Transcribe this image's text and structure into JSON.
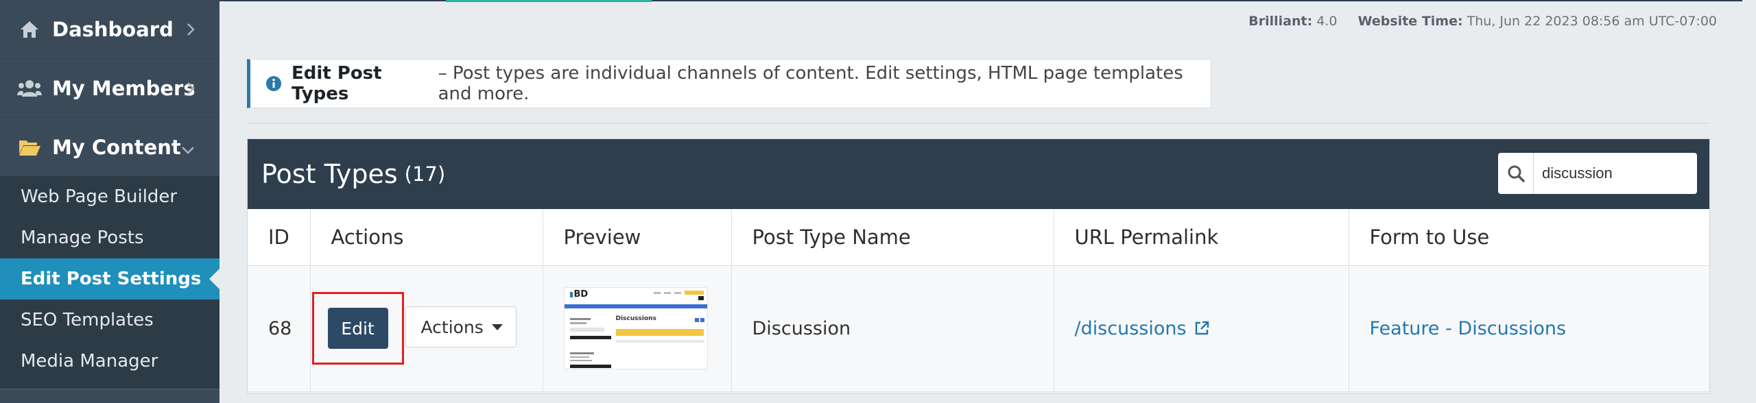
{
  "sidebar": {
    "main_items": [
      {
        "label": "Dashboard",
        "icon": "home-icon"
      },
      {
        "label": "My Members",
        "icon": "users-icon"
      },
      {
        "label": "My Content",
        "icon": "folder-open-icon"
      }
    ],
    "sub_items": [
      {
        "label": "Web Page Builder"
      },
      {
        "label": "Manage Posts"
      },
      {
        "label": "Edit Post Settings",
        "active": true
      },
      {
        "label": "SEO Templates"
      },
      {
        "label": "Media Manager"
      }
    ]
  },
  "meta": {
    "version_label": "Brilliant:",
    "version_value": "4.0",
    "time_label": "Website Time:",
    "time_value": "Thu, Jun 22 2023 08:56 am UTC-07:00"
  },
  "notice": {
    "title": "Edit Post Types",
    "text": "– Post types are individual channels of content. Edit settings, HTML page templates and more."
  },
  "panel": {
    "title": "Post Types",
    "count": "(17)",
    "search_value": "discussion"
  },
  "table": {
    "headers": [
      "ID",
      "Actions",
      "Preview",
      "Post Type Name",
      "URL Permalink",
      "Form to Use"
    ],
    "rows": [
      {
        "id": "68",
        "edit_label": "Edit",
        "actions_label": "Actions",
        "preview": {
          "heading": "Discussions",
          "logo": "BD"
        },
        "name": "Discussion",
        "permalink": "/discussions",
        "form": "Feature - Discussions"
      }
    ]
  },
  "colors": {
    "sidebar_bg": "#3a4a58",
    "submenu_bg": "#2d3b47",
    "active_bg": "#1f8fbc",
    "panel_header": "#2e3e4d",
    "link": "#2279b0",
    "edit_button": "#2c4a66",
    "highlight": "#e02020"
  }
}
